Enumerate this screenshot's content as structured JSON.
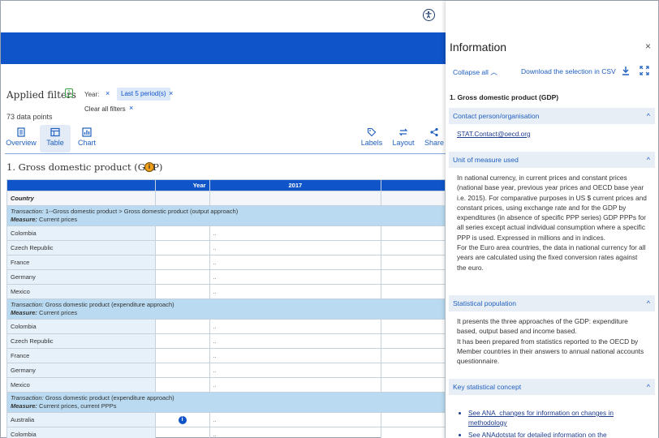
{
  "filters": {
    "title": "Applied filters",
    "count": "1",
    "year_label": "Year:",
    "remove_glyph": "×",
    "chip": "Last 5 period(s)",
    "clear_all": "Clear all filters",
    "datapoints": "73 data points"
  },
  "toolbar": {
    "overview": "Overview",
    "table": "Table",
    "chart": "Chart",
    "labels": "Labels",
    "layout": "Layout",
    "share": "Share"
  },
  "table_title": "1. Gross domestic product (GDP)",
  "table": {
    "year_header": "Year",
    "col_2017": "2017",
    "country_header": "Country",
    "transaction_label": "Transaction:",
    "measure_label": "Measure:",
    "sections": [
      {
        "transaction": "1--Gross domestic product > Gross domestic product (output approach)",
        "measure": "Current prices",
        "rows": [
          {
            "country": "Colombia",
            "v2017": ".."
          },
          {
            "country": "Czech Republic",
            "v2017": ".."
          },
          {
            "country": "France",
            "v2017": ".."
          },
          {
            "country": "Germany",
            "v2017": ".."
          },
          {
            "country": "Mexico",
            "v2017": ".."
          }
        ]
      },
      {
        "transaction": "Gross domestic product (expenditure approach)",
        "measure": "Current prices",
        "rows": [
          {
            "country": "Colombia",
            "v2017": ".."
          },
          {
            "country": "Czech Republic",
            "v2017": ".."
          },
          {
            "country": "France",
            "v2017": ".."
          },
          {
            "country": "Germany",
            "v2017": ".."
          },
          {
            "country": "Mexico",
            "v2017": ".."
          }
        ]
      },
      {
        "transaction": "Gross domestic product (expenditure approach)",
        "measure": "Current prices, current PPPs",
        "rows": [
          {
            "country": "Australia",
            "v2017": "..",
            "info": "i"
          },
          {
            "country": "Colombia",
            "v2017": ".."
          }
        ]
      }
    ]
  },
  "panel": {
    "title": "Information",
    "close": "×",
    "collapse_all": "Collapse all",
    "download": "Download the selection in CSV",
    "subtitle": "1. Gross domestic product (GDP)",
    "chevron": "^",
    "sections": {
      "contact": {
        "title": "Contact person/organisation",
        "email": "STAT.Contact@oecd.org"
      },
      "unit": {
        "title": "Unit of measure used",
        "text1": "In national currency, in current prices and constant prices (national base year, previous year prices and OECD base year i.e. 2015). For comparative purposes in US $ current prices and constant prices, using exchange rate and for the GDP by expenditures (in absence of specific PPP series) GDP PPPs for all series except actual individual consumption where a specific PPP is used. Expressed in millions and in indices.",
        "text2": "For the Euro area countries, the data in national currency for all years are calculated using the fixed conversion rates against the euro."
      },
      "population": {
        "title": "Statistical population",
        "text1": "It presents the three approaches of the GDP: expenditure based, output based and income based.",
        "text2": " It has been prepared from statistics reported to the OECD by Member countries in their answers to annual national accounts questionnaire."
      },
      "concept": {
        "title": "Key statistical concept",
        "bullets": [
          "See ANA_changes for information on changes in methodology",
          "See ANAdotstat for detailed information on the"
        ]
      }
    }
  },
  "colors": {
    "brand_blue": "#0f54c8",
    "accent_orange": "#f2a11c",
    "row_blue": "#b9daf0"
  }
}
